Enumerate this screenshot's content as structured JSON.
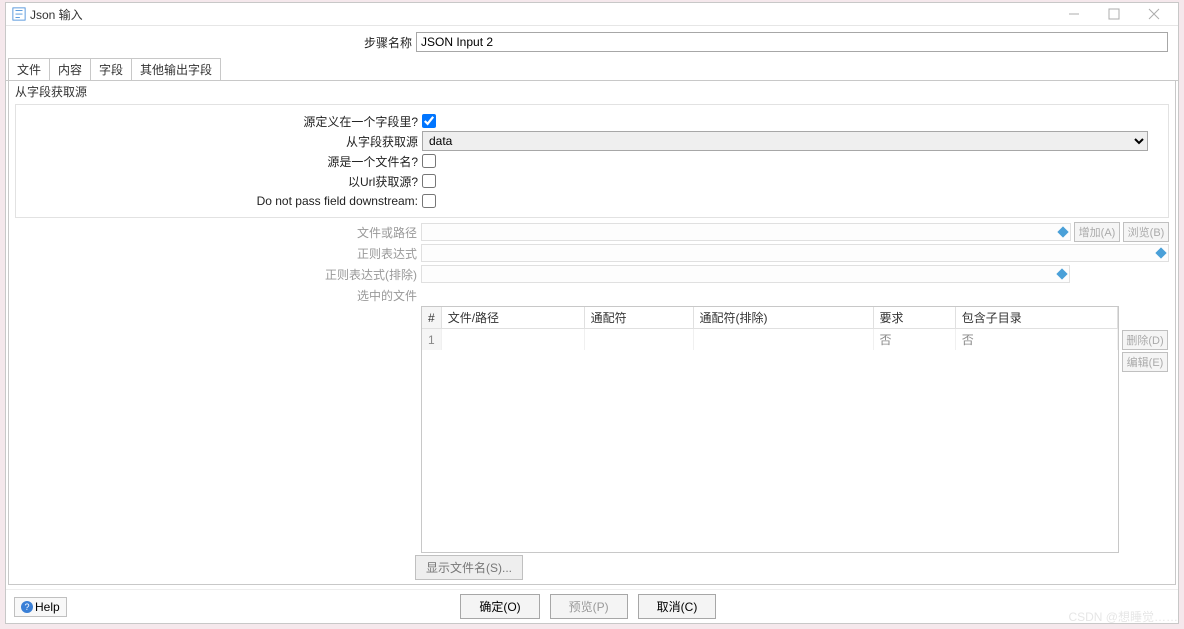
{
  "titlebar": {
    "title": "Json 输入"
  },
  "step": {
    "label": "步骤名称",
    "value": "JSON Input 2"
  },
  "tabs": [
    "文件",
    "内容",
    "字段",
    "其他输出字段"
  ],
  "group_title": "从字段获取源",
  "fields": {
    "source_in_field": {
      "label": "源定义在一个字段里?",
      "checked": true
    },
    "from_field": {
      "label": "从字段获取源",
      "value": "data"
    },
    "is_filename": {
      "label": "源是一个文件名?",
      "checked": false
    },
    "get_by_url": {
      "label": "以Url获取源?",
      "checked": false
    },
    "do_not_pass": {
      "label": "Do not pass field downstream:",
      "checked": false
    }
  },
  "disabled_rows": {
    "file_or_path": "文件或路径",
    "regex": "正则表达式",
    "regex_exclude": "正则表达式(排除)",
    "selected_files": "选中的文件"
  },
  "side_buttons": {
    "add": "增加(A)",
    "browse": "浏览(B)",
    "delete": "删除(D)",
    "edit": "编辑(E)"
  },
  "table": {
    "headers": [
      "#",
      "文件/路径",
      "通配符",
      "通配符(排除)",
      "要求",
      "包含子目录"
    ],
    "rows": [
      {
        "num": "1",
        "file": "",
        "wild": "",
        "wild_ex": "",
        "req": "否",
        "sub": "否"
      }
    ]
  },
  "show_filenames": "显示文件名(S)...",
  "help": "Help",
  "actions": {
    "ok": "确定(O)",
    "preview": "预览(P)",
    "cancel": "取消(C)"
  },
  "watermark": "CSDN @想睡觉……"
}
